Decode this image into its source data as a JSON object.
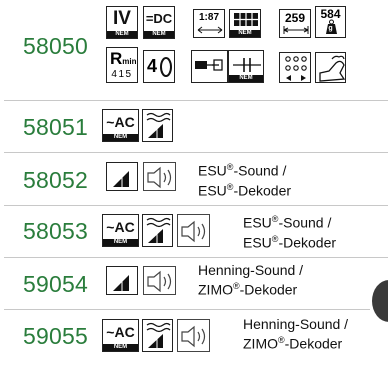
{
  "colors": {
    "article_number": "#2a7d3c",
    "icon_border": "#222222",
    "divider": "#c8c8c8"
  },
  "rows": [
    {
      "number": "58050",
      "icons": {
        "voltage_class": "IV",
        "dc": "=DC",
        "nem_label": "NEM",
        "scale": "1:87",
        "length_mm": "259",
        "weight_g": "584",
        "weight_unit": "g",
        "rmin_label": "R",
        "rmin_sub": "min",
        "rmin_value": "415",
        "axles": "4"
      },
      "icon_names": [
        "voltage-class-iv-icon",
        "dc-nem-icon",
        "scale-ruler-icon",
        "coupling-nem-icon",
        "length-icon",
        "weight-icon",
        "min-radius-icon",
        "driven-axles-icon",
        "coupling-cam-icon",
        "short-coupling-icon",
        "wheel-arrangement-icon",
        "smoke-generator-icon"
      ]
    },
    {
      "number": "58051",
      "icons": {
        "ac": "~AC",
        "nem_label": "NEM"
      }
    },
    {
      "number": "58052",
      "sound_line1": "ESU",
      "sound_line1_suffix": "-Sound /",
      "sound_line2": "ESU",
      "sound_line2_suffix": "-Dekoder",
      "reg": "®"
    },
    {
      "number": "58053",
      "icons": {
        "ac": "~AC",
        "nem_label": "NEM"
      },
      "sound_line1": "ESU",
      "sound_line1_suffix": "-Sound /",
      "sound_line2": "ESU",
      "sound_line2_suffix": "-Dekoder",
      "reg": "®"
    },
    {
      "number": "59054",
      "sound_line1": "Henning-Sound /",
      "sound_line2": "ZIMO",
      "sound_line2_suffix": "-Dekoder",
      "reg": "®"
    },
    {
      "number": "59055",
      "icons": {
        "ac": "~AC",
        "nem_label": "NEM"
      },
      "sound_line1": "Henning-Sound /",
      "sound_line2": "ZIMO",
      "sound_line2_suffix": "-Dekoder",
      "reg": "®"
    }
  ]
}
